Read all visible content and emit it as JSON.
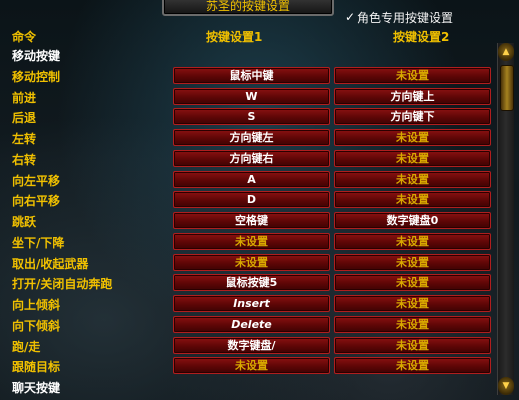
{
  "title": "苏圣的按键设置",
  "character_option": {
    "label": "角色专用按键设置",
    "checked": true
  },
  "columns": {
    "command": "命令",
    "key1": "按键设置1",
    "key2": "按键设置2"
  },
  "rows": [
    {
      "type": "section",
      "label": "移动按键"
    },
    {
      "type": "binding",
      "label": "移动控制",
      "key1": "鼠标中键",
      "key1_set": true,
      "key2": "未设置",
      "key2_set": false
    },
    {
      "type": "binding",
      "label": "前进",
      "key1": "W",
      "key1_set": true,
      "key2": "方向键上",
      "key2_set": true
    },
    {
      "type": "binding",
      "label": "后退",
      "key1": "S",
      "key1_set": true,
      "key2": "方向键下",
      "key2_set": true
    },
    {
      "type": "binding",
      "label": "左转",
      "key1": "方向键左",
      "key1_set": true,
      "key2": "未设置",
      "key2_set": false
    },
    {
      "type": "binding",
      "label": "右转",
      "key1": "方向键右",
      "key1_set": true,
      "key2": "未设置",
      "key2_set": false
    },
    {
      "type": "binding",
      "label": "向左平移",
      "key1": "A",
      "key1_set": true,
      "key2": "未设置",
      "key2_set": false
    },
    {
      "type": "binding",
      "label": "向右平移",
      "key1": "D",
      "key1_set": true,
      "key2": "未设置",
      "key2_set": false
    },
    {
      "type": "binding",
      "label": "跳跃",
      "key1": "空格键",
      "key1_set": true,
      "key2": "数字键盘0",
      "key2_set": true
    },
    {
      "type": "binding",
      "label": "坐下/下降",
      "key1": "未设置",
      "key1_set": false,
      "key2": "未设置",
      "key2_set": false
    },
    {
      "type": "binding",
      "label": "取出/收起武器",
      "key1": "未设置",
      "key1_set": false,
      "key2": "未设置",
      "key2_set": false
    },
    {
      "type": "binding",
      "label": "打开/关闭自动奔跑",
      "key1": "鼠标按键5",
      "key1_set": true,
      "key2": "未设置",
      "key2_set": false
    },
    {
      "type": "binding",
      "label": "向上倾斜",
      "key1": "Insert",
      "key1_set": true,
      "key1_italic": true,
      "key2": "未设置",
      "key2_set": false
    },
    {
      "type": "binding",
      "label": "向下倾斜",
      "key1": "Delete",
      "key1_set": true,
      "key1_italic": true,
      "key2": "未设置",
      "key2_set": false
    },
    {
      "type": "binding",
      "label": "跑/走",
      "key1": "数字键盘/",
      "key1_set": true,
      "key2": "未设置",
      "key2_set": false
    },
    {
      "type": "binding",
      "label": "跟随目标",
      "key1": "未设置",
      "key1_set": false,
      "key2": "未设置",
      "key2_set": false
    },
    {
      "type": "section",
      "label": "聊天按键"
    }
  ],
  "colors": {
    "gold": "#f0c000",
    "button_red": "#6e0808",
    "unset_text": "#d8a800"
  }
}
